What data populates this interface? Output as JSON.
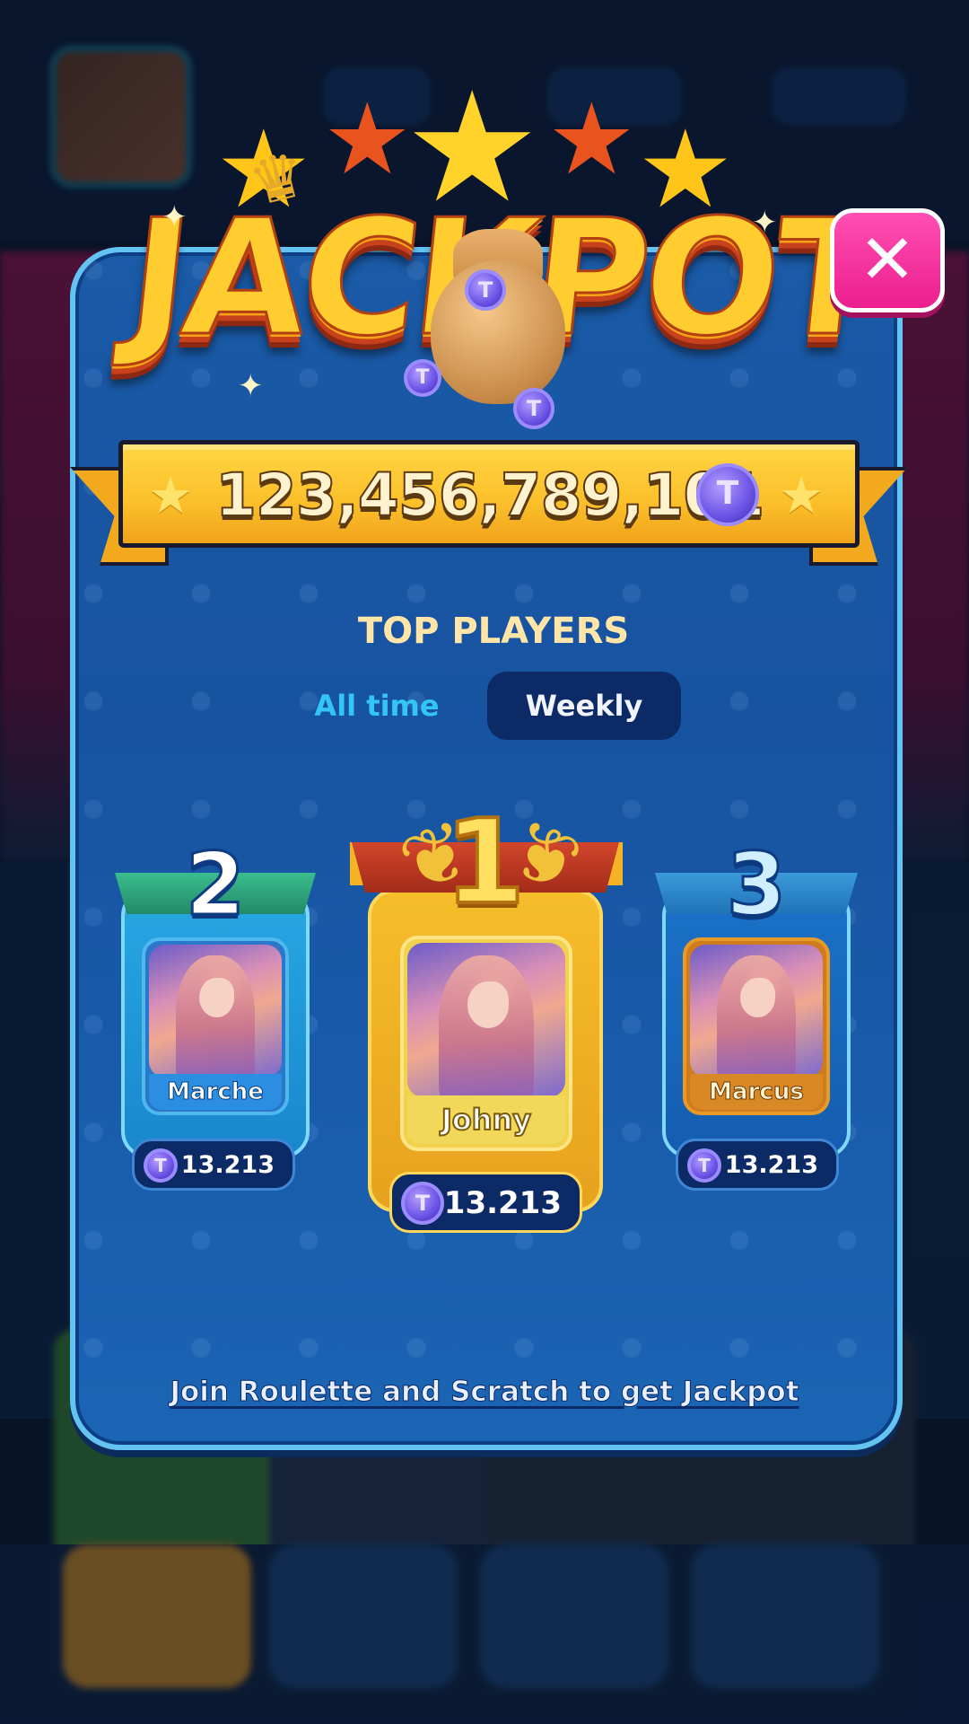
{
  "jackpot": {
    "title": "JACKPOT",
    "amount": "123,456,789,101",
    "coin_symbol": "T",
    "currency_icon": "coin-icon"
  },
  "top_players": {
    "title": "TOP PLAYERS",
    "tabs": [
      {
        "label": "All time",
        "active": false
      },
      {
        "label": "Weekly",
        "active": true
      }
    ],
    "podium": [
      {
        "rank": "2",
        "name": "Marche",
        "score": "13.213"
      },
      {
        "rank": "1",
        "name": "Johny",
        "score": "13.213"
      },
      {
        "rank": "3",
        "name": "Marcus",
        "score": "13.213"
      }
    ]
  },
  "footer": {
    "link_text": "Join Roulette and Scratch to get Jackpot"
  },
  "close": {
    "icon": "close-icon",
    "glyph": "✕"
  },
  "colors": {
    "panel": "#1a5aa6",
    "gold": "#fbbf2a",
    "close": "#ec1e8e",
    "tab_active": "#0b2a66",
    "tab_inactive_text": "#33c6f4"
  }
}
